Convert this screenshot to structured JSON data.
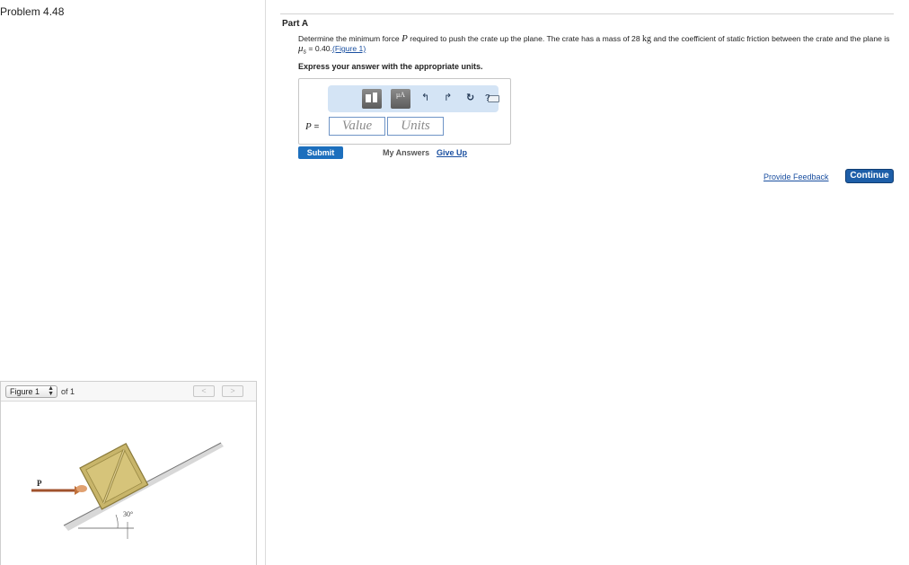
{
  "problem": {
    "title": "Problem 4.48"
  },
  "figure_panel": {
    "select_value": "Figure 1",
    "of_text": "of 1",
    "prev_label": "<",
    "next_label": ">",
    "force_label": "P",
    "angle_label": "30°"
  },
  "part": {
    "label": "Part A",
    "question_pre": "Determine the minimum force ",
    "question_var": "P",
    "question_mid": " required to push the crate up the plane. The crate has a mass of 28 ",
    "question_unit": "kg",
    "question_post": " and the coefficient of static friction between the crate and the plane is ",
    "mu_symbol": "μ",
    "mu_sub": "s",
    "mu_value": " = 0.40.",
    "figure_link": "(Figure 1)",
    "instruction": "Express your answer with the appropriate units."
  },
  "answer": {
    "toolbar_tile_label": "μA",
    "undo_icon": "↰",
    "redo_icon": "↱",
    "reset_icon": "↻",
    "help_label": "?",
    "p_var": "P",
    "p_equals": " =",
    "value_placeholder": "Value",
    "units_placeholder": "Units"
  },
  "actions": {
    "submit_label": "Submit",
    "my_answers_label": "My Answers",
    "give_up_label": "Give Up",
    "feedback_label": "Provide Feedback",
    "continue_label": "Continue"
  },
  "colors": {
    "accent": "#1d6fbd",
    "link": "#1a4fa0",
    "toolbar_bg": "#d4e4f5",
    "crate": "#c8b56a"
  }
}
